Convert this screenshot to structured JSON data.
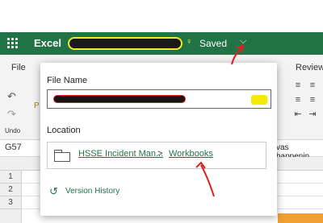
{
  "app": {
    "name": "Excel",
    "status": "Saved",
    "menu_icon": "waffle-icon",
    "chevron_icon": "chevron-down-icon"
  },
  "ribbon": {
    "tabs": [
      "File",
      "Review"
    ],
    "undo_label": "Undo"
  },
  "namebox": {
    "cell": "G57",
    "formula_preview": "vas happenin"
  },
  "grid": {
    "rows": [
      "1",
      "2",
      "3"
    ]
  },
  "file_popup": {
    "file_name_label": "File Name",
    "location_label": "Location",
    "location_path": [
      "HSSE Incident Man...",
      "Workbooks"
    ],
    "separator": ">",
    "version_history": "Version History"
  },
  "colors": {
    "brand": "#217346",
    "annotation": "#e02020",
    "highlight": "#f4e900"
  }
}
